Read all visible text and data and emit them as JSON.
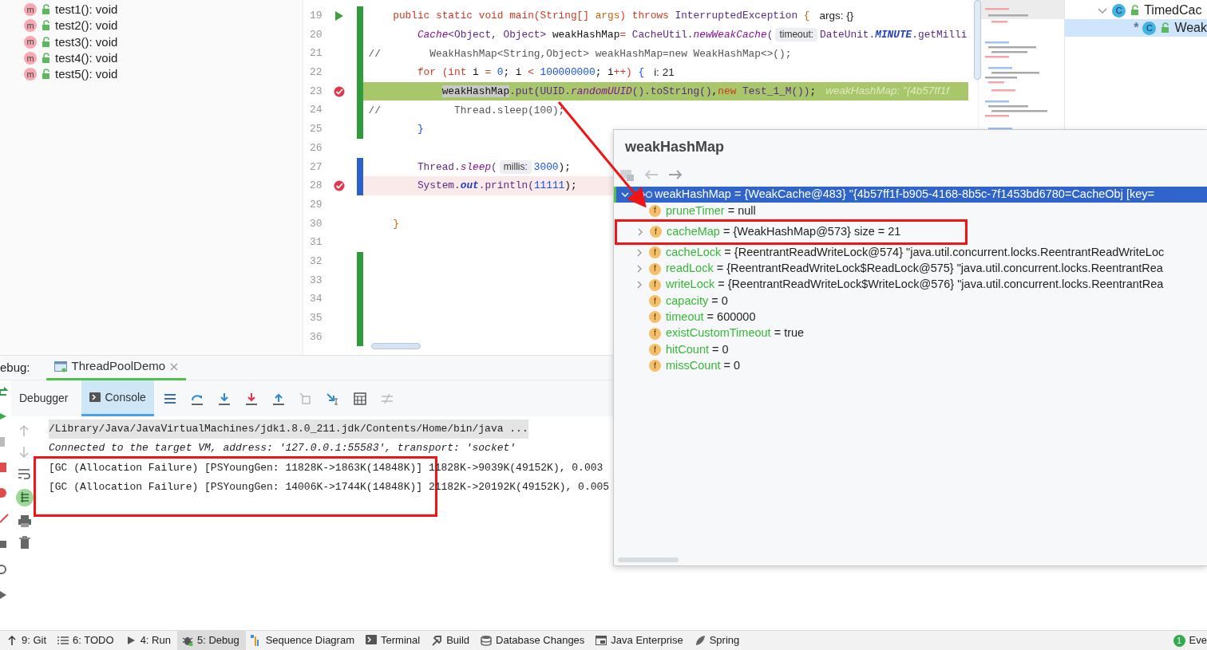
{
  "structure": {
    "items": [
      {
        "badge": "m",
        "label": "test1(): void"
      },
      {
        "badge": "m",
        "label": "test2(): void"
      },
      {
        "badge": "m",
        "label": "test3(): void"
      },
      {
        "badge": "m",
        "label": "test4(): void"
      },
      {
        "badge": "m",
        "label": "test5(): void"
      }
    ]
  },
  "editor": {
    "lines": [
      {
        "number": "19",
        "run_marker": true,
        "breakpoint": false,
        "current": false,
        "color": "#2f9b3a",
        "segments": [
          {
            "kind": "kw",
            "text": "    public static void main(String[] "
          },
          {
            "kind": "param",
            "text": "args"
          },
          {
            "kind": "kw",
            "text": ") throws "
          },
          {
            "kind": "type",
            "text": "InterruptedException "
          },
          {
            "kind": "param",
            "text": "{"
          },
          {
            "kind": "value",
            "text": "args: {}"
          }
        ]
      },
      {
        "number": "20",
        "run_marker": false,
        "breakpoint": false,
        "current": false,
        "color": "#2f9b3a",
        "segments": [
          {
            "kind": "method",
            "text": "        Cache"
          },
          {
            "kind": "type",
            "text": "<Object, Object> "
          },
          {
            "kind": "plain",
            "text": "weakHashMap"
          },
          {
            "kind": "kw",
            "text": "= "
          },
          {
            "kind": "type",
            "text": "CacheUtil."
          },
          {
            "kind": "method",
            "text": "newWeakCache"
          },
          {
            "kind": "type",
            "text": "("
          },
          {
            "kind": "hint",
            "text": "timeout:"
          },
          {
            "kind": "type",
            "text": "DateUnit."
          },
          {
            "kind": "static",
            "text": "MINUTE"
          },
          {
            "kind": "type",
            "text": ".getMilli"
          }
        ]
      },
      {
        "number": "21",
        "run_marker": false,
        "breakpoint": false,
        "current": false,
        "color": "#2f9b3a",
        "segments": [
          {
            "kind": "comment",
            "text": "//        WeakHashMap<String,Object> weakHashMap=new WeakHashMap<>();"
          }
        ]
      },
      {
        "number": "22",
        "run_marker": false,
        "breakpoint": false,
        "current": false,
        "color": "#2f9b3a",
        "segments": [
          {
            "kind": "kw",
            "text": "        for (int "
          },
          {
            "kind": "plain",
            "text": "i "
          },
          {
            "kind": "kw",
            "text": "= "
          },
          {
            "kind": "num",
            "text": "0"
          },
          {
            "kind": "plain",
            "text": "; i "
          },
          {
            "kind": "kw",
            "text": "< "
          },
          {
            "kind": "num",
            "text": "100000000"
          },
          {
            "kind": "plain",
            "text": "; i"
          },
          {
            "kind": "kw",
            "text": "++) "
          },
          {
            "kind": "punct",
            "text": "{"
          },
          {
            "kind": "value",
            "text": "i: 21"
          }
        ]
      },
      {
        "number": "23",
        "run_marker": false,
        "breakpoint": true,
        "current": true,
        "color": "#2f9b3a",
        "segments": [
          {
            "kind": "ref",
            "text": "            weakHashMap"
          },
          {
            "kind": "type",
            "text": ".put("
          },
          {
            "kind": "type",
            "text": "UUID."
          },
          {
            "kind": "method",
            "text": "randomUUID"
          },
          {
            "kind": "type",
            "text": "().toString()"
          },
          {
            "kind": "plain",
            "text": ","
          },
          {
            "kind": "kw",
            "text": "new "
          },
          {
            "kind": "type",
            "text": "Test_1_M())"
          },
          {
            "kind": "plain",
            "text": ";"
          },
          {
            "kind": "value",
            "text": "weakHashMap: \"{4b57ff1f"
          }
        ]
      },
      {
        "number": "24",
        "run_marker": false,
        "breakpoint": false,
        "current": false,
        "color": "#2f9b3a",
        "segments": [
          {
            "kind": "comment",
            "text": "//            Thread.sleep(100);"
          }
        ]
      },
      {
        "number": "25",
        "run_marker": false,
        "breakpoint": false,
        "current": false,
        "color": "#2f9b3a",
        "segments": [
          {
            "kind": "punct",
            "text": "        }"
          }
        ]
      },
      {
        "number": "26",
        "run_marker": false,
        "breakpoint": false,
        "current": false
      },
      {
        "number": "27",
        "run_marker": false,
        "breakpoint": false,
        "current": false,
        "color": "#2b62c9",
        "segments": [
          {
            "kind": "type",
            "text": "        Thread."
          },
          {
            "kind": "method",
            "text": "sleep"
          },
          {
            "kind": "type",
            "text": "("
          },
          {
            "kind": "hint",
            "text": "millis:"
          },
          {
            "kind": "num",
            "text": "3000"
          },
          {
            "kind": "plain",
            "text": ");"
          }
        ]
      },
      {
        "number": "28",
        "run_marker": false,
        "breakpoint": true,
        "current": false,
        "color": "#2b62c9",
        "segments": [
          {
            "kind": "type",
            "text": "        System."
          },
          {
            "kind": "static",
            "text": "out"
          },
          {
            "kind": "type",
            "text": ".println("
          },
          {
            "kind": "num",
            "text": "11111"
          },
          {
            "kind": "plain",
            "text": ");"
          }
        ]
      },
      {
        "number": "29",
        "run_marker": false,
        "breakpoint": false,
        "current": false
      },
      {
        "number": "30",
        "run_marker": false,
        "breakpoint": false,
        "current": false,
        "segments": [
          {
            "kind": "param",
            "text": "    }"
          }
        ]
      },
      {
        "number": "31",
        "run_marker": false,
        "breakpoint": false,
        "current": false
      },
      {
        "number": "32",
        "run_marker": false,
        "breakpoint": false,
        "current": false,
        "color": "#2f9b3a"
      },
      {
        "number": "33",
        "run_marker": false,
        "breakpoint": false,
        "current": false,
        "color": "#2f9b3a"
      },
      {
        "number": "34",
        "run_marker": false,
        "breakpoint": false,
        "current": false,
        "color": "#2f9b3a"
      },
      {
        "number": "35",
        "run_marker": false,
        "breakpoint": false,
        "current": false,
        "color": "#2f9b3a"
      },
      {
        "number": "36",
        "run_marker": false,
        "breakpoint": false,
        "current": false,
        "color": "#2f9b3a"
      }
    ]
  },
  "class_tree": {
    "items": [
      {
        "label": "TimedCac",
        "badge": "C",
        "expanded": true,
        "selected": false,
        "children": [
          {
            "marker": "*",
            "label": "Weak",
            "badge": "C",
            "selected": true
          }
        ]
      }
    ]
  },
  "debug": {
    "label": "ebug:",
    "session_tab": {
      "label": "ThreadPoolDemo"
    },
    "tabs": [
      {
        "label": "Debugger",
        "selected": false
      },
      {
        "label": "Console",
        "selected": true
      }
    ],
    "console": {
      "lines": [
        {
          "kind": "command",
          "text": "/Library/Java/JavaVirtualMachines/jdk1.8.0_211.jdk/Contents/Home/bin/java ...",
          "annotated": false
        },
        {
          "kind": "info",
          "text": "Connected to the target VM, address: '127.0.0.1:55583', transport: 'socket'",
          "annotated": false
        },
        {
          "kind": "output",
          "text": "[GC (Allocation Failure) [PSYoungGen: 11828K->1863K(14848K)] 11828K->9039K(49152K), 0.003",
          "annotated": true
        },
        {
          "kind": "output",
          "text": "[GC (Allocation Failure) [PSYoungGen: 14006K->1744K(14848K)] 21182K->20192K(49152K), 0.005",
          "annotated": true
        }
      ]
    }
  },
  "popup": {
    "title": "weakHashMap",
    "callout_arrow": true,
    "tree": [
      {
        "name": "weakHashMap",
        "value": " = {WeakCache@483} \"{4b57ff1f-b905-4168-8b5c-7f1453bd6780=CacheObj [key=",
        "expanded": true,
        "selected": true,
        "children": [
          {
            "icon_text": "f",
            "name": "pruneTimer",
            "value": " = null",
            "expandable": false,
            "annotated": false
          },
          {
            "icon_text": "f",
            "name": "cacheMap",
            "value": " = {WeakHashMap@573}  size = 21",
            "expandable": true,
            "annotated": true
          },
          {
            "icon_text": "f",
            "name": "cacheLock",
            "value": " = {ReentrantReadWriteLock@574} \"java.util.concurrent.locks.ReentrantReadWriteLoc",
            "expandable": true,
            "annotated": false
          },
          {
            "icon_text": "f",
            "name": "readLock",
            "value": " = {ReentrantReadWriteLock$ReadLock@575} \"java.util.concurrent.locks.ReentrantRea",
            "expandable": true,
            "annotated": false
          },
          {
            "icon_text": "f",
            "name": "writeLock",
            "value": " = {ReentrantReadWriteLock$WriteLock@576} \"java.util.concurrent.locks.ReentrantRea",
            "expandable": true,
            "annotated": false
          },
          {
            "icon_text": "f",
            "name": "capacity",
            "value": " = 0",
            "expandable": false,
            "annotated": false
          },
          {
            "icon_text": "f",
            "name": "timeout",
            "value": " = 600000",
            "expandable": false,
            "annotated": false
          },
          {
            "icon_text": "f",
            "name": "existCustomTimeout",
            "value": " = true",
            "expandable": false,
            "annotated": false
          },
          {
            "icon_text": "f",
            "name": "hitCount",
            "value": " = 0",
            "expandable": false,
            "annotated": false
          },
          {
            "icon_text": "f",
            "name": "missCount",
            "value": " = 0",
            "expandable": false,
            "annotated": false
          }
        ]
      }
    ]
  },
  "status_bar": {
    "items": [
      {
        "kind": "git",
        "label": "9: Git",
        "selected": false
      },
      {
        "kind": "todo",
        "label": "6: TODO",
        "selected": false
      },
      {
        "kind": "run",
        "label": "4: Run",
        "selected": false
      },
      {
        "kind": "debug",
        "label": "5: Debug",
        "selected": true
      },
      {
        "kind": "sequence",
        "label": "Sequence Diagram",
        "selected": false
      },
      {
        "kind": "terminal",
        "label": "Terminal",
        "selected": false
      },
      {
        "kind": "build",
        "label": "Build",
        "selected": false
      },
      {
        "kind": "database",
        "label": "Database Changes",
        "selected": false
      },
      {
        "kind": "enterprise",
        "label": "Java Enterprise",
        "selected": false
      },
      {
        "kind": "spring",
        "label": "Spring",
        "selected": false
      }
    ],
    "event_count": "1",
    "event_label": "Eve"
  }
}
